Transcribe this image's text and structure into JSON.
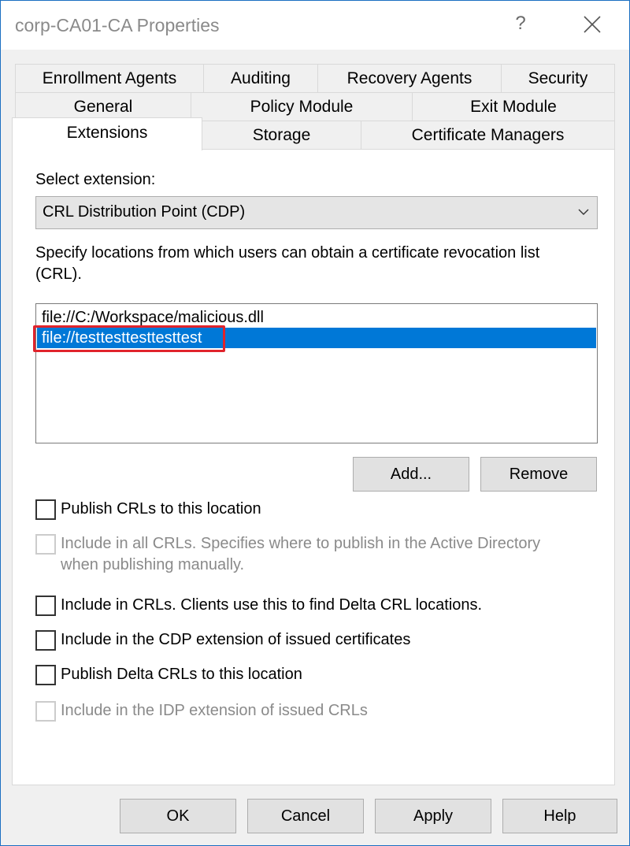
{
  "window": {
    "title": "corp-CA01-CA Properties",
    "help_glyph": "?",
    "close_icon": "close-icon"
  },
  "tabs": {
    "row1": [
      "Enrollment Agents",
      "Auditing",
      "Recovery Agents",
      "Security"
    ],
    "row2": [
      "General",
      "Policy Module",
      "Exit Module"
    ],
    "row3": [
      "Extensions",
      "Storage",
      "Certificate Managers"
    ],
    "active": "Extensions"
  },
  "extensions": {
    "select_label": "Select extension:",
    "selected_extension": "CRL Distribution Point (CDP)",
    "description": "Specify locations from which users can obtain a certificate revocation list (CRL).",
    "locations": [
      {
        "text": "file://C:/Workspace/malicious.dll",
        "selected": false
      },
      {
        "text": "file://testtesttesttesttest",
        "selected": true
      }
    ],
    "highlight_color": "#e0242c",
    "selection_color": "#0078d7",
    "add_label": "Add...",
    "remove_label": "Remove",
    "options": [
      {
        "label": "Publish CRLs to this location",
        "checked": false,
        "enabled": true
      },
      {
        "label_line1": "Include in all CRLs. Specifies where to publish in the Active Directory",
        "label_line2": "when publishing manually.",
        "checked": false,
        "enabled": false
      },
      {
        "label": "Include in CRLs. Clients use this to find Delta CRL locations.",
        "checked": false,
        "enabled": true
      },
      {
        "label": "Include in the CDP extension of issued certificates",
        "checked": false,
        "enabled": true
      },
      {
        "label": "Publish Delta CRLs to this location",
        "checked": false,
        "enabled": true
      },
      {
        "label": "Include in the IDP extension of issued CRLs",
        "checked": false,
        "enabled": false
      }
    ]
  },
  "footer": {
    "ok": "OK",
    "cancel": "Cancel",
    "apply": "Apply",
    "help": "Help"
  }
}
